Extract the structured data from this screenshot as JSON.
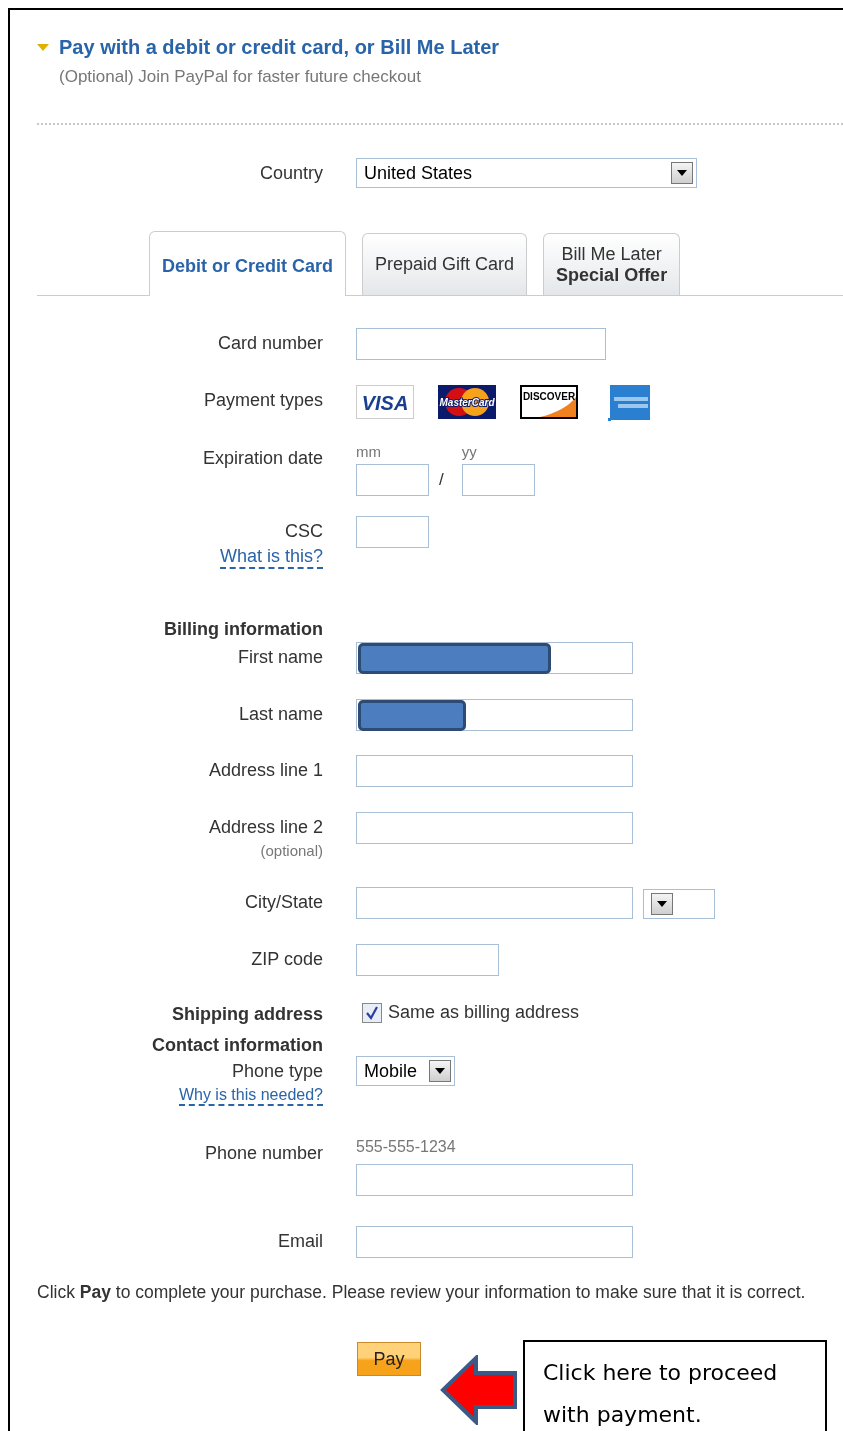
{
  "header": {
    "title": "Pay with a debit or credit card, or Bill Me Later",
    "subtitle": "(Optional) Join PayPal for faster future checkout",
    "expanded": true
  },
  "country": {
    "label": "Country",
    "value": "United States"
  },
  "tabs": [
    {
      "label": "Debit or Credit Card",
      "selected": true
    },
    {
      "label": "Prepaid Gift Card",
      "selected": false
    },
    {
      "label": "Bill Me Later",
      "sublabel": "Special Offer",
      "selected": false
    }
  ],
  "card": {
    "card_number": {
      "label": "Card number"
    },
    "payment_types": {
      "label": "Payment types",
      "cards": [
        {
          "kind": "visa",
          "label": "VISA"
        },
        {
          "kind": "mastercard",
          "label": "MasterCard"
        },
        {
          "kind": "discover",
          "label": "DISCOVER"
        },
        {
          "kind": "amex"
        }
      ]
    },
    "expiration": {
      "label": "Expiration date",
      "month_label": "mm",
      "year_label": "yy",
      "separator": "/"
    },
    "csc": {
      "label": "CSC",
      "help_link": "What is this?"
    }
  },
  "billing": {
    "heading": "Billing information",
    "first_name": {
      "label": "First name",
      "redacted": true
    },
    "last_name": {
      "label": "Last name",
      "redacted": true
    },
    "address_line_1": {
      "label": "Address line 1"
    },
    "address_line_2": {
      "label": "Address line 2",
      "note": "(optional)"
    },
    "city_state": {
      "label": "City/State"
    },
    "zip": {
      "label": "ZIP code"
    }
  },
  "shipping": {
    "heading": "Shipping address",
    "same_as_billing": {
      "label": "Same as billing address",
      "checked": true
    }
  },
  "contact": {
    "heading": "Contact information",
    "phone_type": {
      "label": "Phone type",
      "value": "Mobile",
      "help_link": "Why is this needed?"
    },
    "phone_number": {
      "label": "Phone number",
      "hint": "555-555-1234"
    },
    "email": {
      "label": "Email"
    }
  },
  "instructions": "Click **Pay** to complete your purchase. Please review your information to make sure that it is correct.",
  "pay_button": "Pay",
  "callout": "Click here to proceed with payment."
}
